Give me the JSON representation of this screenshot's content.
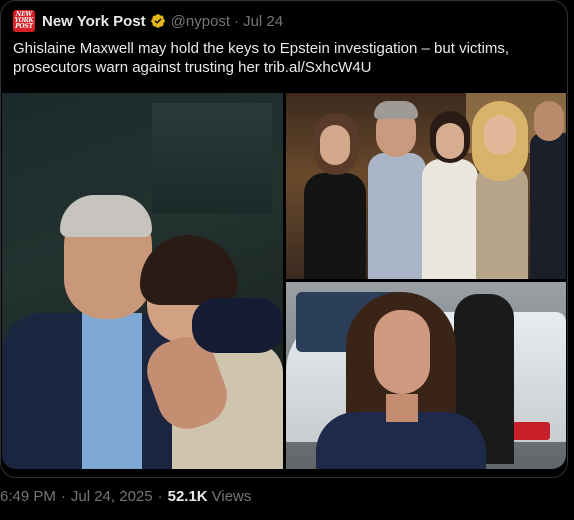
{
  "tweet": {
    "account_name": "New York Post",
    "handle": "@nypost",
    "separator": "·",
    "date": "Jul 24",
    "avatar_text_line1": "NEW",
    "avatar_text_line2": "YORK",
    "avatar_text_line3": "POST",
    "text": "Ghislaine Maxwell may hold the keys to Epstein investigation – but victims, prosecutors warn against trusting her ",
    "link": "trib.al/SxhcW4U",
    "verified_icon": "verified-badge-icon"
  },
  "media": {
    "photos": [
      {
        "id": "photo-1",
        "kind": "couple-portrait"
      },
      {
        "id": "photo-2",
        "kind": "group-photo"
      },
      {
        "id": "photo-3",
        "kind": "street-photo"
      }
    ]
  },
  "meta": {
    "time": "6:49 PM",
    "separator": "·",
    "date": "Jul 24, 2025",
    "separator2": "·",
    "views_count": "52.1K",
    "views_label": "Views"
  },
  "colors": {
    "background": "#000000",
    "text_primary": "#e7e9ea",
    "text_secondary": "#71767b",
    "brand_red": "#d61f26",
    "verified_gold": "#e2b719"
  }
}
